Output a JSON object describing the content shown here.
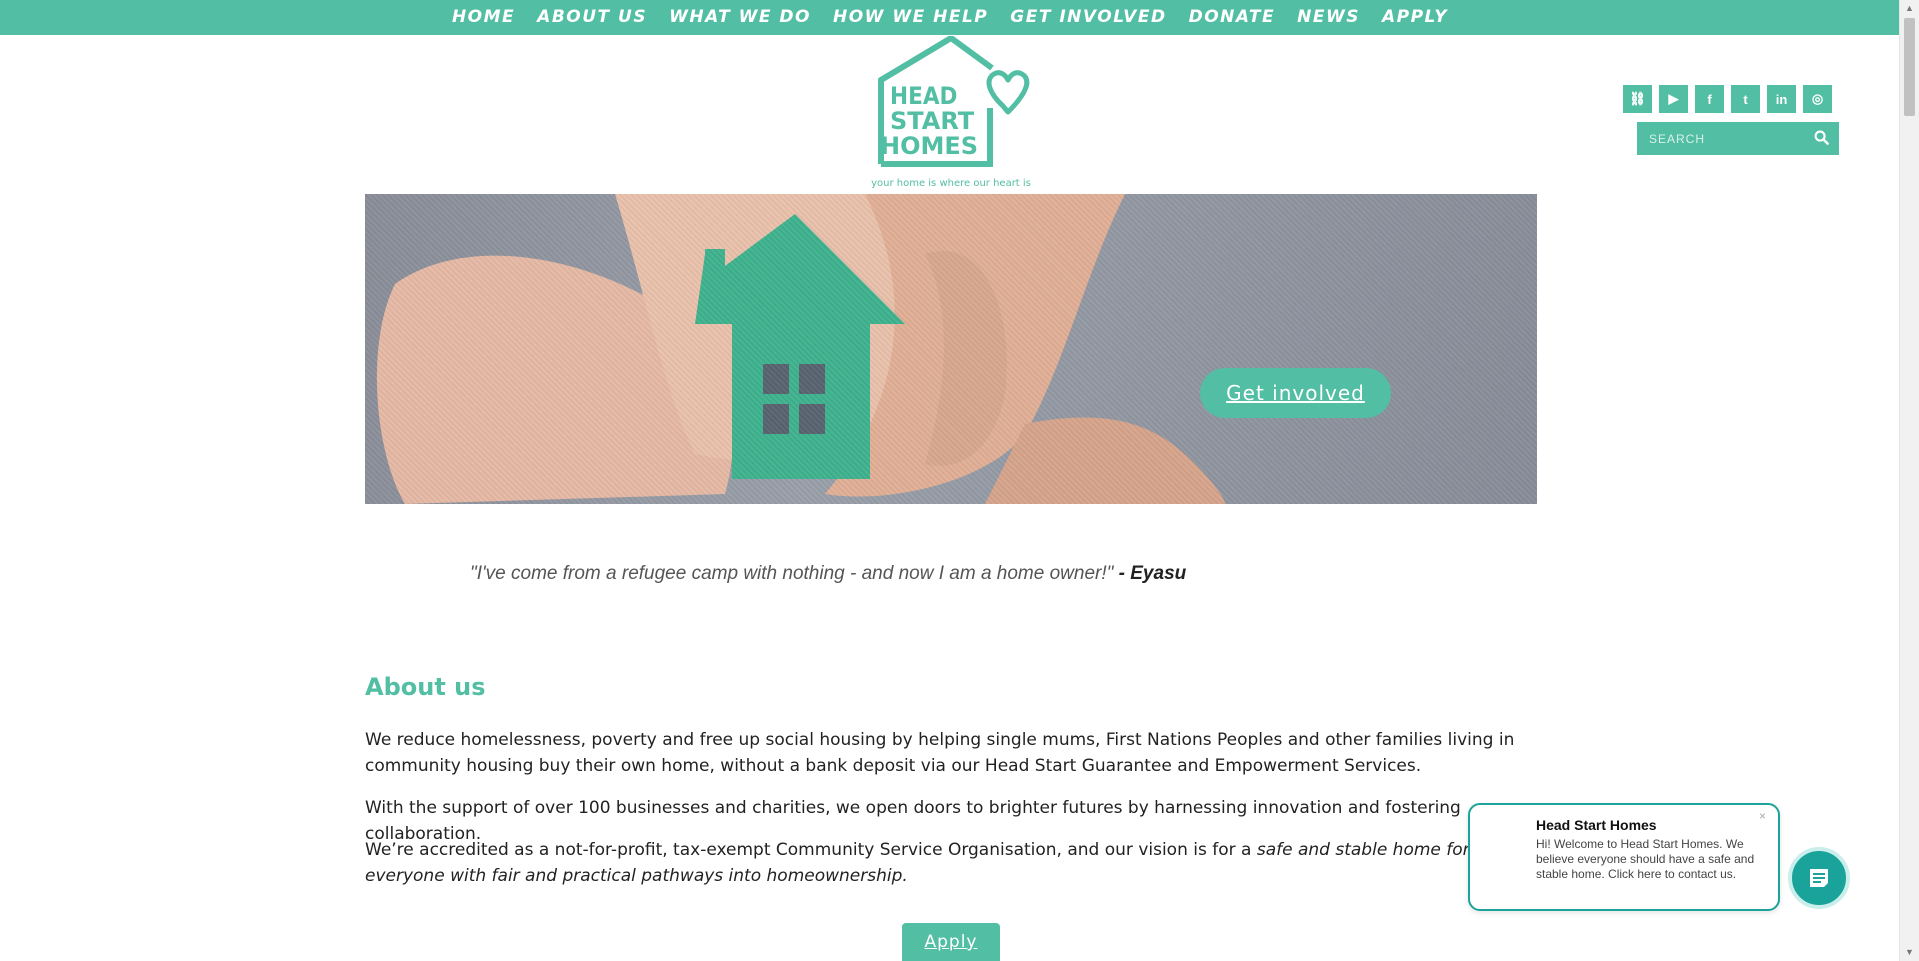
{
  "nav": {
    "items": [
      "HOME",
      "ABOUT US",
      "WHAT WE DO",
      "HOW WE HELP",
      "GET INVOLVED",
      "DONATE",
      "NEWS",
      "APPLY"
    ]
  },
  "logo": {
    "text_lines": [
      "HEAD",
      "START",
      "HOMES"
    ],
    "tagline": "your home is where our heart is"
  },
  "social": {
    "icons": [
      "link-icon",
      "youtube-icon",
      "facebook-icon",
      "twitter-icon",
      "linkedin-icon",
      "instagram-icon"
    ],
    "glyphs": [
      "⛓",
      "▶",
      "f",
      "t",
      "in",
      "◎"
    ]
  },
  "search": {
    "placeholder": "SEARCH"
  },
  "hero": {
    "cta_label": "Get involved"
  },
  "quote": {
    "text": "\"I've come from a refugee camp with nothing - and now I am a home owner!\"",
    "author": "- Eyasu"
  },
  "about": {
    "heading": "About us",
    "p1": "We reduce homelessness, poverty and free up social housing by helping single mums, First Nations Peoples and other families living in community housing buy their own home, without a bank deposit via our Head Start Guarantee and Empowerment Services.",
    "p2": "With the support of over 100 businesses and charities, we open doors to brighter futures by harnessing innovation and fostering collaboration.",
    "p3_plain": "We’re accredited as a not-for-profit, tax-exempt Community Service Organisation, and our vision is for a ",
    "p3_italic": "safe and stable home for everyone with fair and practical pathways into homeownership.",
    "apply_label": "Apply"
  },
  "chat": {
    "title": "Head Start Homes",
    "message": "Hi! Welcome to Head Start Homes. We believe everyone should have a safe and stable home. Click here to contact us.",
    "close": "×"
  },
  "colors": {
    "brand": "#52bea3",
    "chat": "#1aa39a"
  }
}
